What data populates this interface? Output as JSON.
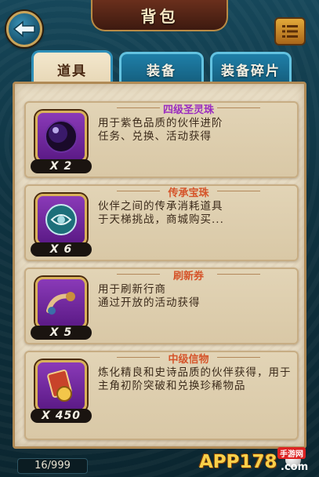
{
  "header": {
    "title": "背包"
  },
  "tabs": [
    {
      "label": "道具",
      "active": true
    },
    {
      "label": "装备",
      "active": false
    },
    {
      "label": "装备碎片",
      "active": false
    }
  ],
  "items": [
    {
      "name": "四级圣灵珠",
      "qty": "X 2",
      "desc": "用于紫色品质的伙伴进阶\n任务、兑换、活动获得",
      "icon": "purple-orb-icon"
    },
    {
      "name": "传承宝珠",
      "qty": "X 6",
      "desc": "伙伴之间的传承消耗道具\n于天梯挑战，商城购买...",
      "icon": "inheritance-orb-icon"
    },
    {
      "name": "刷新券",
      "qty": "X 5",
      "desc": "用于刷新行商\n通过开放的活动获得",
      "icon": "refresh-ticket-icon"
    },
    {
      "name": "中级信物",
      "qty": "X 450",
      "desc": "炼化精良和史诗品质的伙伴获得，用于主角初阶突破和兑换珍稀物品",
      "icon": "token-icon"
    }
  ],
  "footer": {
    "count": "16/999"
  },
  "watermark": {
    "text": "APP178",
    "suffix": ".com",
    "badge": "手游网"
  },
  "colors": {
    "accent": "#2e8fb8",
    "panel": "#e7dcc4",
    "item_name_purple": "#9b2cc0",
    "item_name_orange": "#d5542a"
  }
}
